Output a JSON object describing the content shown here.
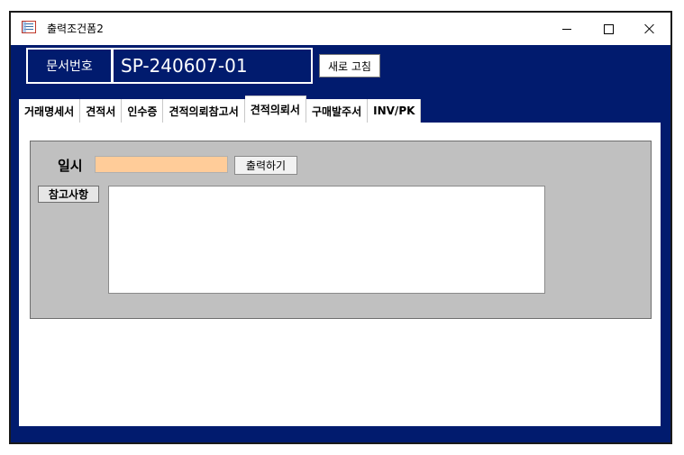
{
  "window": {
    "title": "출력조건폼2",
    "app_icon": "access-form-icon",
    "controls": [
      "minimize-icon",
      "maximize-icon",
      "close-icon"
    ]
  },
  "header": {
    "doc_number_label": "문서번호",
    "doc_number_value": "SP-240607-01",
    "refresh_label": "새로 고침"
  },
  "tabs": [
    {
      "label": "거래명세서",
      "active": false
    },
    {
      "label": "견적서",
      "active": false
    },
    {
      "label": "인수증",
      "active": false
    },
    {
      "label": "견적의뢰참고서",
      "active": false
    },
    {
      "label": "견적의뢰서",
      "active": true
    },
    {
      "label": "구매발주서",
      "active": false
    },
    {
      "label": "INV/PK",
      "active": false
    }
  ],
  "panel": {
    "date_label": "일시",
    "date_value": "",
    "print_button": "출력하기",
    "notes_label": "참고사항",
    "notes_value": ""
  },
  "colors": {
    "form_background": "#011b6e",
    "date_field": "#ffcc99",
    "panel_background": "#c0c0c0"
  }
}
